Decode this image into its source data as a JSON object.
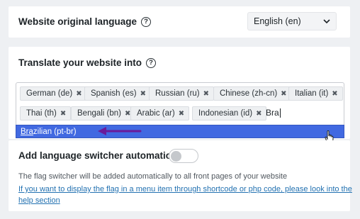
{
  "language_section": {
    "title": "Website original language",
    "help_icon": "?",
    "selected_language": "English (en)"
  },
  "translate_section": {
    "title": "Translate your website into",
    "help_icon": "?",
    "tags": [
      {
        "label": "German (de)"
      },
      {
        "label": "Spanish (es)"
      },
      {
        "label": "Russian (ru)"
      },
      {
        "label": "Chinese (zh-cn)"
      },
      {
        "label": "Italian (it)"
      },
      {
        "label": "Thai (th)"
      },
      {
        "label": "Bengali (bn)"
      },
      {
        "label": "Arabic (ar)"
      },
      {
        "label": "Indonesian (id)"
      }
    ],
    "remove_glyph": "✖",
    "search_value": "Bra",
    "suggestion": {
      "match": "Bra",
      "rest": "zilian (pt-br)"
    }
  },
  "switcher_section": {
    "title": "Add language switcher automatically",
    "toggle_on": false,
    "description": "The flag switcher will be added automatically to all front pages of your website",
    "help_link_line1": "If you want to display the flag in a menu item through shortcode or php code, please look into the",
    "help_link_line2": "help section"
  },
  "colors": {
    "highlight": "#4169e1",
    "arrow": "#6a1b9a",
    "link": "#2271b1"
  }
}
